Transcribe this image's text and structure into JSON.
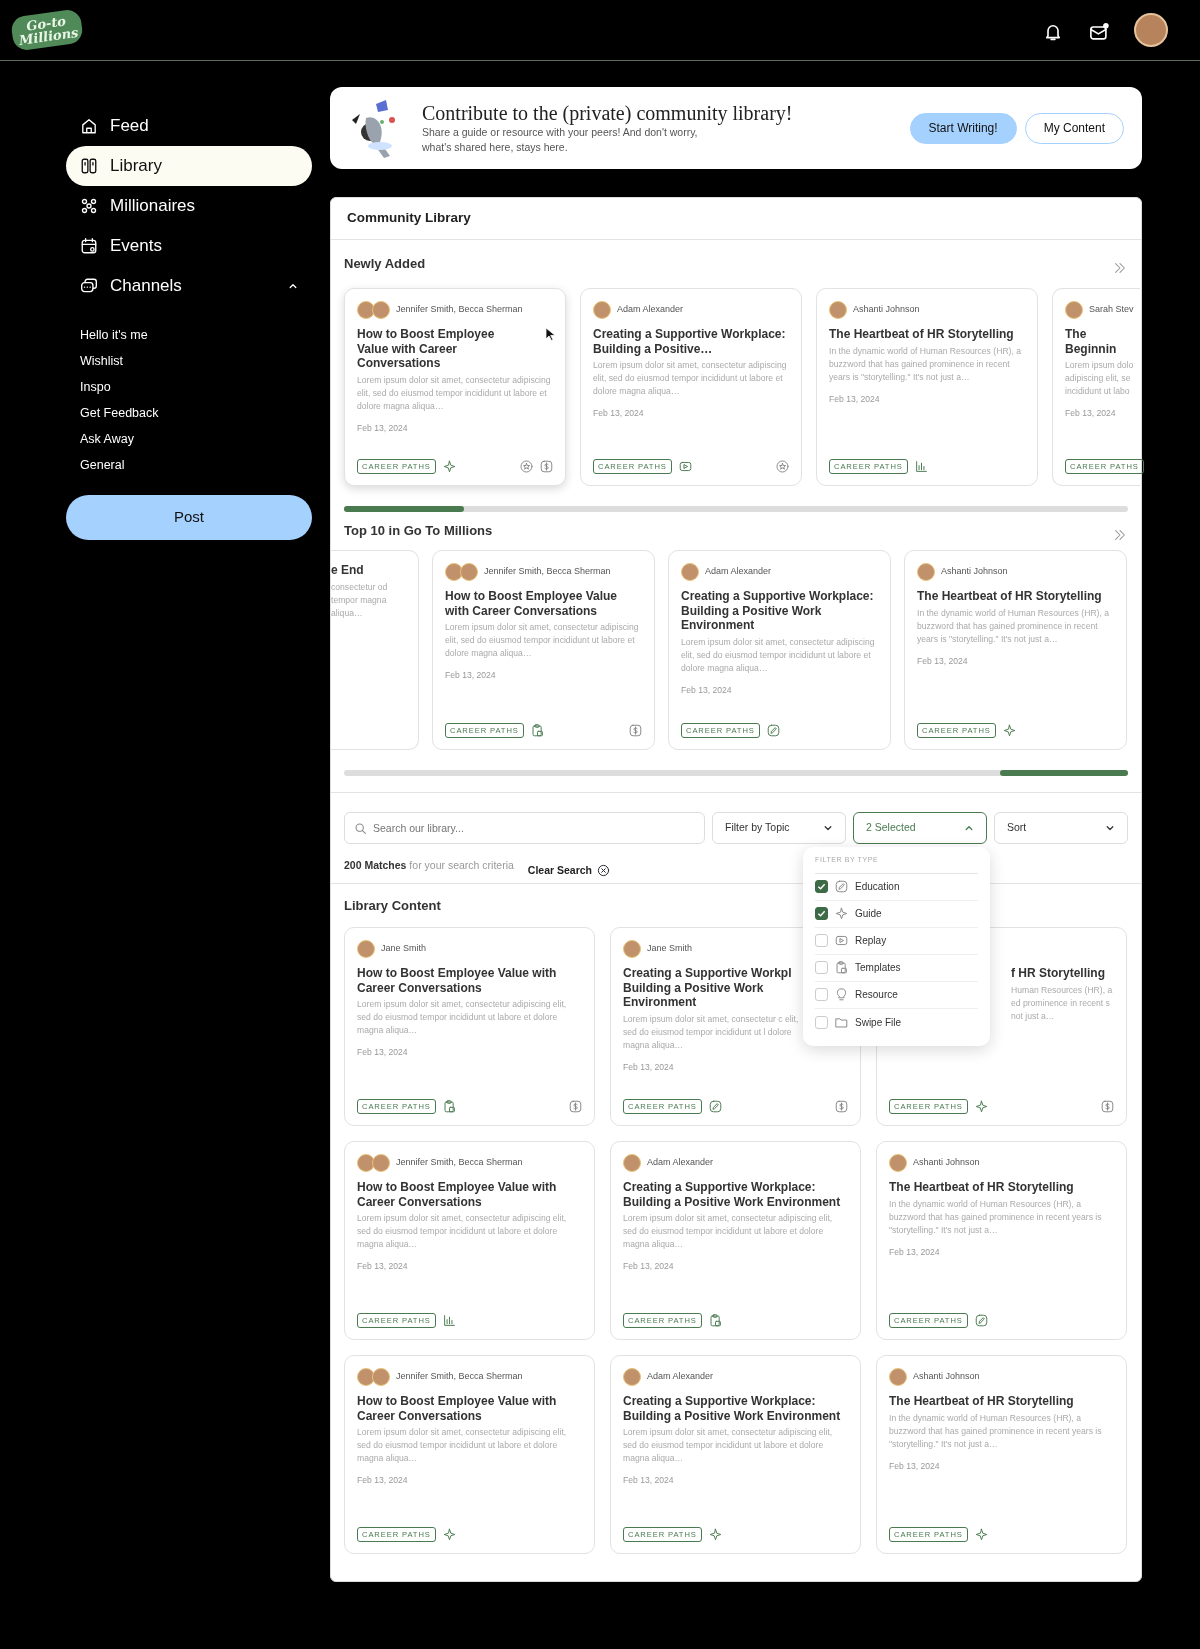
{
  "top_bar": {
    "logo": "Go-to Millions"
  },
  "sidebar": {
    "items": [
      {
        "label": "Feed",
        "kind": "home",
        "selected": false
      },
      {
        "label": "Library",
        "kind": "library",
        "selected": true
      },
      {
        "label": "Millionaires",
        "kind": "people",
        "selected": false
      },
      {
        "label": "Events",
        "kind": "calendar",
        "selected": false
      },
      {
        "label": "Channels",
        "kind": "chat",
        "selected": false,
        "expanded": true,
        "children": [
          {
            "label": "Hello it's me"
          },
          {
            "label": "Wishlist"
          },
          {
            "label": "Inspo"
          },
          {
            "label": "Get Feedback"
          },
          {
            "label": "Ask Away"
          },
          {
            "label": "General"
          }
        ]
      }
    ],
    "post_button": "Post"
  },
  "banner": {
    "title": "Contribute to the (private) community library!",
    "text": "Share a guide or resource with your peers! And don't worry, what's shared here, stays here.",
    "buttons": [
      {
        "label": "Start Writing!",
        "kind": "primary"
      },
      {
        "label": "My Content",
        "kind": "outline"
      }
    ]
  },
  "library": {
    "title": "Community Library",
    "carousels": [
      {
        "title": "Newly Added",
        "scrolled_to_end": false,
        "cards": [
          {
            "clipped": false,
            "avatars": [
              {
                "kind": "photo"
              },
              {
                "kind": "photo"
              }
            ],
            "authors": "Jennifer Smith, Becca Sherman",
            "title": "How to Boost Employee Value with Career Conversations",
            "excerpt": "Lorem ipsum dolor sit amet, consectetur adipiscing elit, sed do eiusmod tempor incididunt ut labore et dolore magna aliqua…",
            "date": "Feb 13, 2024",
            "tag": "CAREER PATHS",
            "kind": "guide",
            "star": true,
            "dollar": true,
            "hovered": true
          },
          {
            "clipped": false,
            "avatars": [
              {
                "kind": "photo"
              }
            ],
            "authors": "Adam Alexander",
            "title": "Creating a Supportive Workplace: Building a Positive…",
            "excerpt": "Lorem ipsum dolor sit amet, consectetur adipiscing elit, sed do eiusmod tempor incididunt ut labore et dolore magna aliqua…",
            "date": "Feb 13, 2024",
            "tag": "CAREER PATHS",
            "kind": "replay",
            "star": true,
            "dollar": false,
            "hovered": false
          },
          {
            "clipped": false,
            "avatars": [
              {
                "kind": "photo"
              }
            ],
            "authors": "Ashanti Johnson",
            "title": "The Heartbeat of HR Storytelling",
            "excerpt": "In the dynamic world of Human Resources (HR), a buzzword that has gained prominence in recent years is \"storytelling.\" It's not just a…",
            "date": "Feb 13, 2024",
            "tag": "CAREER PATHS",
            "kind": "chart",
            "star": false,
            "dollar": false,
            "hovered": false
          },
          {
            "clipped": true,
            "avatars": [
              {
                "kind": "photo"
              }
            ],
            "authors": "Sarah Stev",
            "title": "The Beginnin",
            "excerpt": "Lorem ipsum dolo adipiscing elit, se incididunt ut labo",
            "date": "Feb 13, 2024",
            "tag": "CAREER PATHS",
            "hovered": false
          }
        ]
      },
      {
        "title": "Top 10 in Go To Millions",
        "scrolled_to_end": true,
        "cards": [
          {
            "clipped": true,
            "title": "e End",
            "excerpt": "consectetur od tempor magna aliqua…"
          },
          {
            "clipped": false,
            "avatars": [
              {
                "kind": "photo"
              },
              {
                "kind": "photo"
              }
            ],
            "authors": "Jennifer Smith, Becca Sherman",
            "title": "How to Boost Employee Value with Career Conversations",
            "excerpt": "Lorem ipsum dolor sit amet, consectetur adipiscing elit, sed do eiusmod tempor incididunt ut labore et dolore magna aliqua…",
            "date": "Feb 13, 2024",
            "tag": "CAREER PATHS",
            "kind": "templates",
            "star": false,
            "dollar": true
          },
          {
            "clipped": false,
            "avatars": [
              {
                "kind": "photo"
              }
            ],
            "authors": "Adam Alexander",
            "title": "Creating a Supportive Workplace: Building a Positive Work Environment",
            "excerpt": "Lorem ipsum dolor sit amet, consectetur adipiscing elit, sed do eiusmod tempor incididunt ut labore et dolore magna aliqua…",
            "date": "Feb 13, 2024",
            "tag": "CAREER PATHS",
            "kind": "education",
            "star": false,
            "dollar": false
          },
          {
            "clipped": false,
            "avatars": [
              {
                "kind": "photo"
              }
            ],
            "authors": "Ashanti Johnson",
            "title": "The Heartbeat of HR Storytelling",
            "excerpt": "In the dynamic world of Human Resources (HR), a buzzword that has gained prominence in recent years is \"storytelling.\" It's not just a…",
            "date": "Feb 13, 2024",
            "tag": "CAREER PATHS",
            "kind": "guide",
            "star": false,
            "dollar": false
          }
        ]
      }
    ],
    "search": {
      "placeholder": "Search our library..."
    },
    "filters": [
      {
        "label": "Filter by Topic",
        "open": false
      },
      {
        "label": "2 Selected",
        "open": true,
        "menu": {
          "title": "FILTER BY TYPE",
          "options": [
            {
              "label": "Education",
              "kind": "education",
              "checked": true
            },
            {
              "label": "Guide",
              "kind": "guide",
              "checked": true
            },
            {
              "label": "Replay",
              "kind": "replay",
              "checked": false
            },
            {
              "label": "Templates",
              "kind": "templates",
              "checked": false
            },
            {
              "label": "Resource",
              "kind": "resource",
              "checked": false
            },
            {
              "label": "Swipe File",
              "kind": "swipe",
              "checked": false
            }
          ]
        }
      },
      {
        "label": "Sort",
        "open": false
      }
    ],
    "results": {
      "text": "**200 Matches** for your search criteria",
      "clear": "Clear Search"
    },
    "content": {
      "title": "Library Content",
      "cards": [
        {
          "menu_over_left": false,
          "menu_over_right": false,
          "avatars": [
            {
              "kind": "photo"
            }
          ],
          "authors": "Jane Smith",
          "title": "How to Boost Employee Value with Career Conversations",
          "excerpt": "Lorem ipsum dolor sit amet, consectetur adipiscing elit, sed do eiusmod tempor incididunt ut labore et dolore magna aliqua…",
          "date": "Feb 13, 2024",
          "tag": "CAREER PATHS",
          "kind": "templates",
          "star": false,
          "dollar": true
        },
        {
          "menu_over_left": false,
          "menu_over_right": true,
          "avatars": [
            {
              "kind": "photo"
            }
          ],
          "authors": "Jane Smith",
          "title": "Creating a Supportive Workpl Building a Positive Work Environment",
          "excerpt": "Lorem ipsum dolor sit amet, consectetur c elit, sed do eiusmod tempor incididunt ut l dolore magna aliqua…",
          "date": "Feb 13, 2024",
          "tag": "CAREER PATHS",
          "kind": "education",
          "star": false,
          "dollar": true
        },
        {
          "menu_over_left": true,
          "menu_over_right": false,
          "title": "f HR Storytelling",
          "excerpt": "Human Resources (HR), a ed prominence in recent s not just a…",
          "tag": "CAREER PATHS",
          "kind": "guide",
          "star": false,
          "dollar": true
        },
        {
          "menu_over_left": false,
          "menu_over_right": false,
          "avatars": [
            {
              "kind": "photo"
            },
            {
              "kind": "photo"
            }
          ],
          "authors": "Jennifer Smith, Becca Sherman",
          "title": "How to Boost Employee Value with Career Conversations",
          "excerpt": "Lorem ipsum dolor sit amet, consectetur adipiscing elit, sed do eiusmod tempor incididunt ut labore et dolore magna aliqua…",
          "date": "Feb 13, 2024",
          "tag": "CAREER PATHS",
          "kind": "chart",
          "star": false,
          "dollar": false
        },
        {
          "menu_over_left": false,
          "menu_over_right": false,
          "avatars": [
            {
              "kind": "photo"
            }
          ],
          "authors": "Adam Alexander",
          "title": "Creating a Supportive Workplace: Building a Positive Work Environment",
          "excerpt": "Lorem ipsum dolor sit amet, consectetur adipiscing elit, sed do eiusmod tempor incididunt ut labore et dolore magna aliqua…",
          "date": "Feb 13, 2024",
          "tag": "CAREER PATHS",
          "kind": "templates",
          "star": false,
          "dollar": false
        },
        {
          "menu_over_left": false,
          "menu_over_right": false,
          "avatars": [
            {
              "kind": "photo"
            }
          ],
          "authors": "Ashanti Johnson",
          "title": "The Heartbeat of HR Storytelling",
          "excerpt": "In the dynamic world of Human Resources (HR), a buzzword that has gained prominence in recent years is \"storytelling.\" It's not just a…",
          "date": "Feb 13, 2024",
          "tag": "CAREER PATHS",
          "kind": "education",
          "star": false,
          "dollar": false
        },
        {
          "menu_over_left": false,
          "menu_over_right": false,
          "avatars": [
            {
              "kind": "photo"
            },
            {
              "kind": "photo"
            }
          ],
          "authors": "Jennifer Smith, Becca Sherman",
          "title": "How to Boost Employee Value with Career Conversations",
          "excerpt": "Lorem ipsum dolor sit amet, consectetur adipiscing elit, sed do eiusmod tempor incididunt ut labore et dolore magna aliqua…",
          "date": "Feb 13, 2024",
          "tag": "CAREER PATHS",
          "kind": "guide",
          "star": false,
          "dollar": false
        },
        {
          "menu_over_left": false,
          "menu_over_right": false,
          "avatars": [
            {
              "kind": "photo"
            }
          ],
          "authors": "Adam Alexander",
          "title": "Creating a Supportive Workplace: Building a Positive Work Environment",
          "excerpt": "Lorem ipsum dolor sit amet, consectetur adipiscing elit, sed do eiusmod tempor incididunt ut labore et dolore magna aliqua…",
          "date": "Feb 13, 2024",
          "tag": "CAREER PATHS",
          "kind": "guide",
          "star": false,
          "dollar": false
        },
        {
          "menu_over_left": false,
          "menu_over_right": false,
          "avatars": [
            {
              "kind": "photo"
            }
          ],
          "authors": "Ashanti Johnson",
          "title": "The Heartbeat of HR Storytelling",
          "excerpt": "In the dynamic world of Human Resources (HR), a buzzword that has gained prominence in recent years is \"storytelling.\" It's not just a…",
          "date": "Feb 13, 2024",
          "tag": "CAREER PATHS",
          "kind": "guide",
          "star": false,
          "dollar": false
        }
      ]
    }
  }
}
